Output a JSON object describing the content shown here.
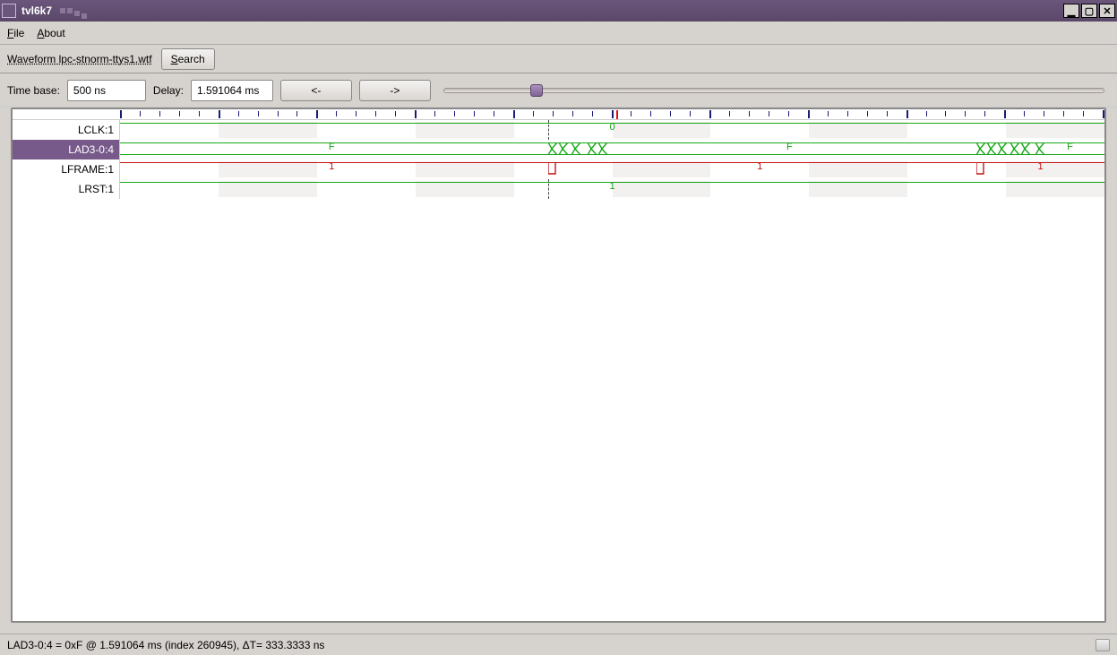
{
  "window": {
    "title": "tvl6k7"
  },
  "menu": {
    "file": "File",
    "about": "About"
  },
  "toolbar1": {
    "waveform_label": "Waveform lpc-stnorm-ttys1.wtf",
    "search_label": "Search"
  },
  "toolbar2": {
    "timebase_label": "Time base:",
    "timebase_value": "500 ns",
    "delay_label": "Delay:",
    "delay_value": "1.591064 ms",
    "prev_label": "<-",
    "next_label": "->"
  },
  "signals": [
    {
      "name": "LCLK:1",
      "selected": false,
      "color": "green-top",
      "center_value": "0"
    },
    {
      "name": "LAD3-0:4",
      "selected": true,
      "color": "bus",
      "values": [
        "F",
        "F",
        "F"
      ]
    },
    {
      "name": "LFRAME:1",
      "selected": false,
      "color": "red-top",
      "values": [
        "1",
        "1",
        "1"
      ]
    },
    {
      "name": "LRST:1",
      "selected": false,
      "color": "green-top",
      "center_value": "1"
    }
  ],
  "status": {
    "text": "LAD3-0:4 = 0xF @ 1.591064 ms  (index 260945), ΔT= 333.3333 ns"
  },
  "colors": {
    "accent": "#775a8a",
    "green": "#18a818",
    "red": "#c41414"
  }
}
